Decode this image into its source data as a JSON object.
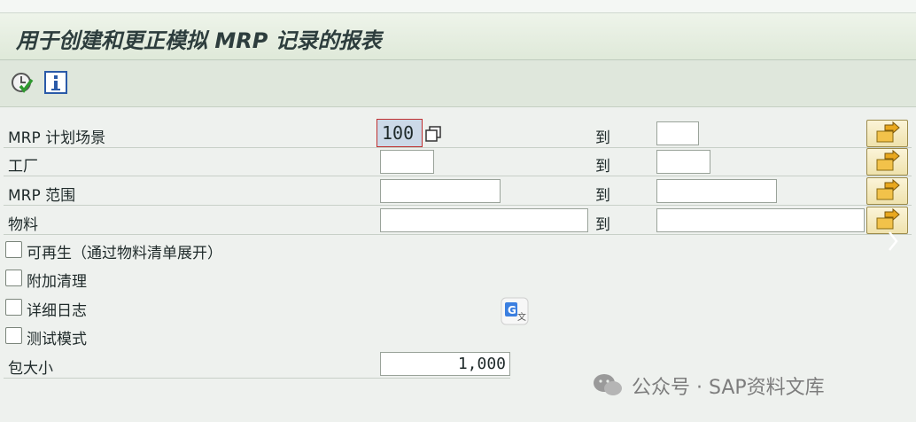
{
  "title": "用于创建和更正模拟 MRP 记录的报表",
  "toolbar": {
    "execute_icon": "execute-clock-check-icon",
    "info_icon": "info-icon"
  },
  "fields": {
    "scenario": {
      "label": "MRP 计划场景",
      "value": "100",
      "to_label": "到"
    },
    "plant": {
      "label": "工厂",
      "to_label": "到"
    },
    "area": {
      "label": "MRP 范围",
      "to_label": "到"
    },
    "material": {
      "label": "物料",
      "to_label": "到"
    }
  },
  "checkboxes": [
    {
      "label": "可再生（通过物料清单展开）",
      "checked": false
    },
    {
      "label": "附加清理",
      "checked": false
    },
    {
      "label": "详细日志",
      "checked": false
    },
    {
      "label": "测试模式",
      "checked": false
    }
  ],
  "package_size": {
    "label": "包大小",
    "value": "1,000"
  },
  "watermark": "公众号 · SAP资料文库",
  "colors": {
    "title_bg": "#e4ede0",
    "selection": "#ccd9e8",
    "multi_button": "#efe2ad"
  }
}
